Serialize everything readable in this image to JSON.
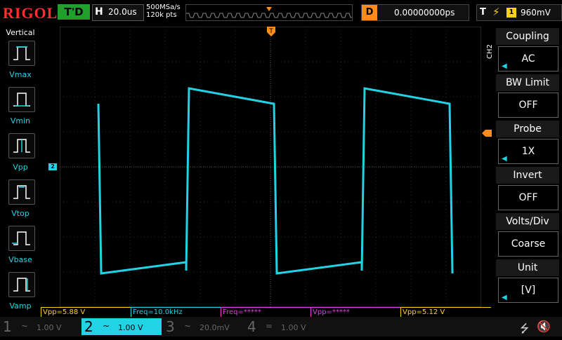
{
  "topbar": {
    "logo": "RIGOL",
    "run_state": "T'D",
    "horizontal": {
      "letter": "H",
      "timebase": "20.0us"
    },
    "sample_rate": "500MSa/s",
    "memory_depth": "120k pts",
    "delay": {
      "letter": "D",
      "value": "0.00000000ps"
    },
    "trigger": {
      "letter": "T",
      "source": "1",
      "level": "960mV",
      "edge_icon": "rising-edge-icon"
    }
  },
  "left_panel": {
    "title": "Vertical",
    "items": [
      {
        "label": "Vmax"
      },
      {
        "label": "Vmin"
      },
      {
        "label": "Vpp"
      },
      {
        "label": "Vtop"
      },
      {
        "label": "Vbase"
      },
      {
        "label": "Vamp"
      }
    ]
  },
  "waveform": {
    "channel": "2",
    "color": "#22d3e6",
    "period_divisions": 5,
    "high_level_frac": 0.25,
    "low_level_frac": 0.85
  },
  "right_menu": {
    "channel_tab": "CH2",
    "items": [
      {
        "title": "Coupling",
        "value": "AC"
      },
      {
        "title": "BW Limit",
        "value": "OFF"
      },
      {
        "title": "Probe",
        "value": "1X"
      },
      {
        "title": "Invert",
        "value": "OFF"
      },
      {
        "title": "Volts/Div",
        "value": "Coarse"
      },
      {
        "title": "Unit",
        "value": "[V]"
      }
    ]
  },
  "measurements": [
    {
      "text": "Vpp=5.88 V",
      "color": "#ffd21a"
    },
    {
      "text": "Freq=10.0kHz",
      "color": "#22d3e6"
    },
    {
      "text": "Freq=*****",
      "color": "#e040e0"
    },
    {
      "text": "Vpp=*****",
      "color": "#e040e0"
    },
    {
      "text": "Vpp=5.12 V",
      "color": "#ffd21a"
    }
  ],
  "channels": [
    {
      "num": "1",
      "coupling": "~",
      "scale": "1.00 V",
      "color": "#666666",
      "active": false
    },
    {
      "num": "2",
      "coupling": "~",
      "scale": "1.00 V",
      "color": "#22d3e6",
      "active": true
    },
    {
      "num": "3",
      "coupling": "~",
      "scale": "20.0mV",
      "color": "#666666",
      "active": false
    },
    {
      "num": "4",
      "coupling": "=",
      "scale": "1.00 V",
      "color": "#666666",
      "active": false
    }
  ],
  "colors": {
    "ch1": "#ffd21a",
    "ch2": "#22d3e6",
    "trigger": "#ff8c1a",
    "run": "#1fa02a"
  }
}
